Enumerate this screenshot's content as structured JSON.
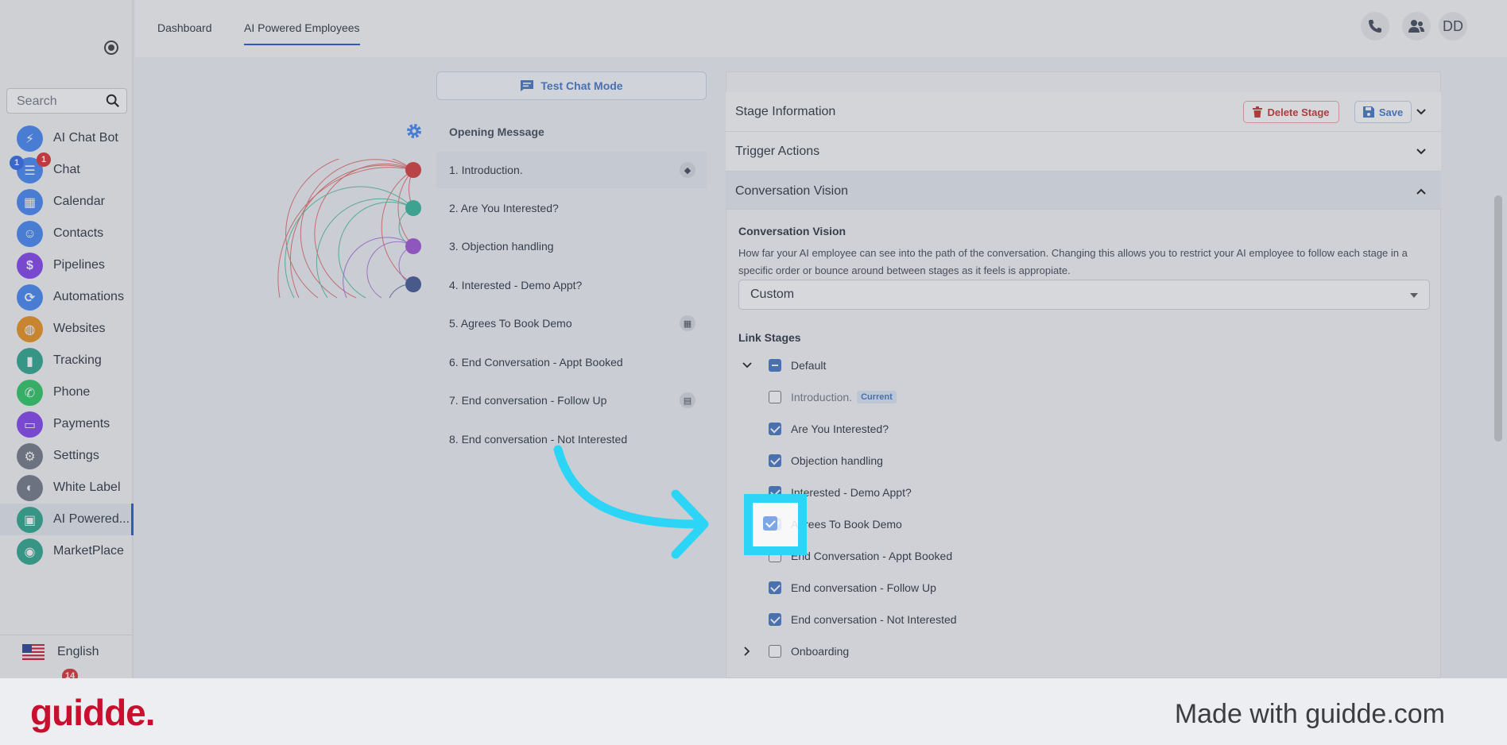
{
  "sidebar": {
    "search_placeholder": "Search",
    "items": [
      {
        "label": "AI Chat Bot",
        "icon": "lightning-icon",
        "color": "#3b82f6"
      },
      {
        "label": "Chat",
        "icon": "chat-icon",
        "color": "#3b82f6",
        "badge": "1",
        "badge2": "1"
      },
      {
        "label": "Calendar",
        "icon": "calendar-icon",
        "color": "#3b82f6"
      },
      {
        "label": "Contacts",
        "icon": "contacts-icon",
        "color": "#3b82f6"
      },
      {
        "label": "Pipelines",
        "icon": "dollar-icon",
        "color": "#7c3aed"
      },
      {
        "label": "Automations",
        "icon": "automation-icon",
        "color": "#3b82f6"
      },
      {
        "label": "Websites",
        "icon": "globe-icon",
        "color": "#ea8c12"
      },
      {
        "label": "Tracking",
        "icon": "chart-icon",
        "color": "#22a38a"
      },
      {
        "label": "Phone",
        "icon": "phone-icon",
        "color": "#22c55e"
      },
      {
        "label": "Payments",
        "icon": "credit-card-icon",
        "color": "#7c3aed"
      },
      {
        "label": "Settings",
        "icon": "gear-icon",
        "color": "#6b7280"
      },
      {
        "label": "White Label",
        "icon": "palette-icon",
        "color": "#6b7280"
      },
      {
        "label": "AI Powered...",
        "icon": "ai-chat-icon",
        "color": "#22a38a"
      },
      {
        "label": "MarketPlace",
        "icon": "marketplace-icon",
        "color": "#22a38a"
      }
    ],
    "language": "English",
    "bottom_badge": "14"
  },
  "topbar": {
    "tabs": [
      "Dashboard",
      "AI Powered Employees"
    ],
    "avatar": "DD"
  },
  "stages": {
    "test_chat": "Test Chat Mode",
    "items": [
      "Opening Message",
      "1. Introduction.",
      "2. Are You Interested?",
      "3. Objection handling",
      "4. Interested - Demo Appt?",
      "5. Agrees To Book Demo",
      "6. End Conversation - Appt Booked",
      "7. End conversation - Follow Up",
      "8. End conversation - Not Interested"
    ]
  },
  "panel": {
    "stage_info": "Stage Information",
    "delete_label": "Delete Stage",
    "save_label": "Save",
    "trigger_actions": "Trigger Actions",
    "conversation_vision": "Conversation Vision",
    "cv_title": "Conversation Vision",
    "cv_desc": "How far your AI employee can see into the path of the conversation. Changing this allows you to restrict your AI employee to follow each stage in a specific order or bounce around between stages as it feels is appropiate.",
    "select_value": "Custom",
    "link_stages": "Link Stages",
    "group_default": "Default",
    "current_badge": "Current",
    "links": [
      {
        "label": "Introduction.",
        "checked": false
      },
      {
        "label": "Are You Interested?",
        "checked": true
      },
      {
        "label": "Objection handling",
        "checked": true
      },
      {
        "label": "Interested - Demo Appt?",
        "checked": true
      },
      {
        "label": "Agrees To Book Demo",
        "checked": true
      },
      {
        "label": "End Conversation - Appt Booked",
        "checked": false
      },
      {
        "label": "End conversation - Follow Up",
        "checked": true
      },
      {
        "label": "End conversation - Not Interested",
        "checked": true
      }
    ],
    "group_onboarding": "Onboarding"
  },
  "footer": {
    "brand": "guidde.",
    "made_with": "Made with guidde.com"
  },
  "colors": {
    "accent": "#1d4ed8",
    "highlight": "#2cd5f5",
    "danger": "#c62828",
    "brand": "#c8102e"
  }
}
